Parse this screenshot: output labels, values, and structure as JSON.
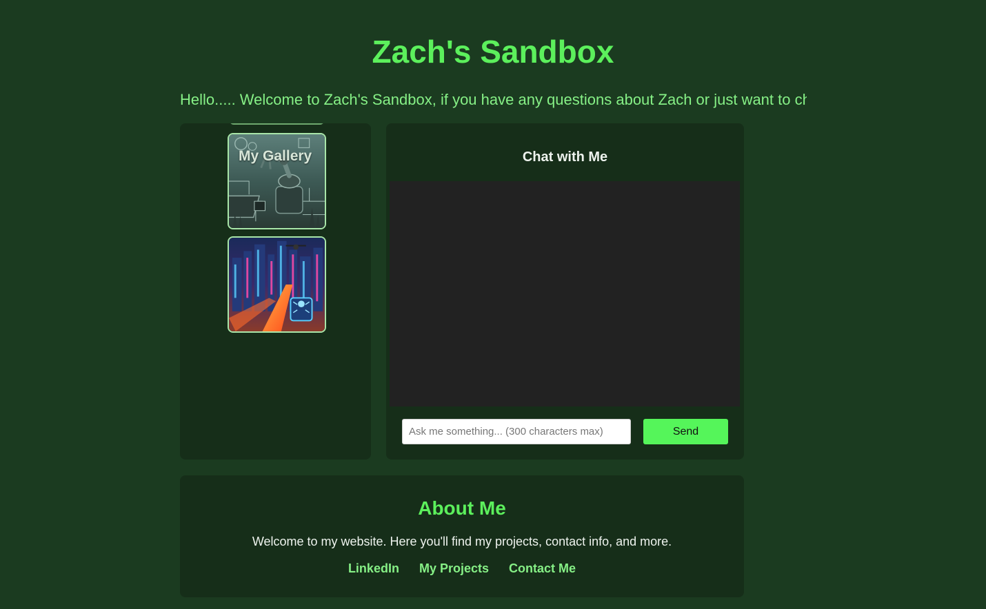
{
  "header": {
    "title": "Zach's Sandbox",
    "marquee": "Hello..... Welcome to Zach's Sandbox, if you have any questions about Zach or just want to chat"
  },
  "gallery": {
    "items": [
      {
        "caption": "My Gallery",
        "image": "robotic-arm-circuit-image"
      },
      {
        "caption": "",
        "image": "ai-cityscape-image"
      }
    ]
  },
  "chat": {
    "title": "Chat with Me",
    "input_placeholder": "Ask me something... (300 characters max)",
    "send_label": "Send"
  },
  "about": {
    "title": "About Me",
    "text": "Welcome to my website. Here you'll find my projects, contact info, and more.",
    "links": [
      "LinkedIn",
      "My Projects",
      "Contact Me"
    ]
  },
  "colors": {
    "background": "#1b3b20",
    "panel": "#162e19",
    "accent": "#5cf05c",
    "button": "#55f55a",
    "chat_log": "#222222"
  }
}
